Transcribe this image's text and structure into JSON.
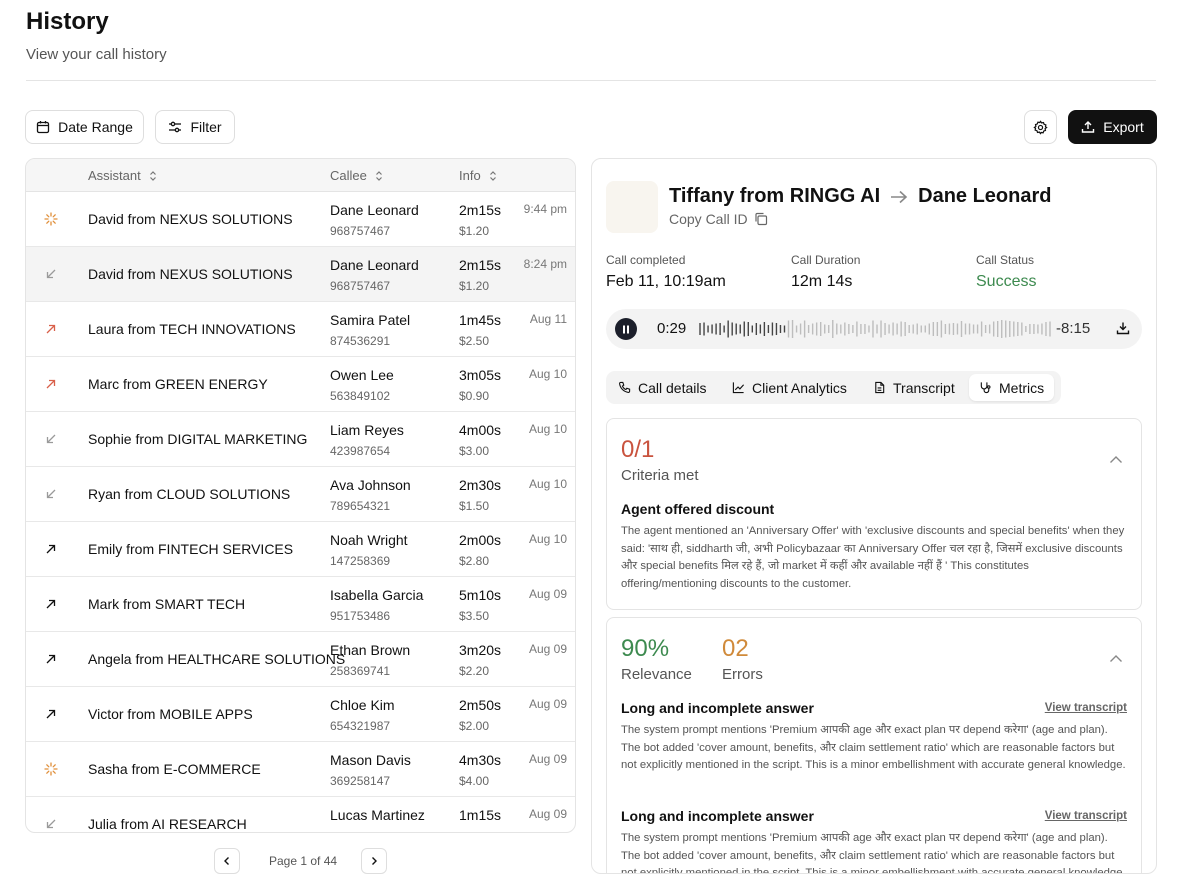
{
  "header": {
    "title": "History",
    "subtitle": "View your call history"
  },
  "toolbar": {
    "date_range_label": "Date Range",
    "filter_label": "Filter",
    "export_label": "Export"
  },
  "table": {
    "columns": [
      "Assistant",
      "Callee",
      "Info"
    ],
    "rows": [
      {
        "icon": "sparkle-icon",
        "assistant": "David from NEXUS SOLUTIONS",
        "callee": "Dane Leonard",
        "phone": "968757467",
        "duration": "2m15s",
        "cost": "$1.20",
        "time": "9:44 pm"
      },
      {
        "icon": "arrow-down-left-icon",
        "assistant": "David from NEXUS SOLUTIONS",
        "callee": "Dane Leonard",
        "phone": "968757467",
        "duration": "2m15s",
        "cost": "$1.20",
        "time": "8:24 pm",
        "selected": true
      },
      {
        "icon": "arrow-up-right-red-icon",
        "assistant": "Laura from TECH INNOVATIONS",
        "callee": "Samira Patel",
        "phone": "874536291",
        "duration": "1m45s",
        "cost": "$2.50",
        "time": "Aug 11"
      },
      {
        "icon": "arrow-up-right-red-icon",
        "assistant": "Marc from GREEN ENERGY",
        "callee": "Owen Lee",
        "phone": "563849102",
        "duration": "3m05s",
        "cost": "$0.90",
        "time": "Aug 10"
      },
      {
        "icon": "arrow-down-left-icon",
        "assistant": "Sophie from DIGITAL MARKETING",
        "callee": "Liam Reyes",
        "phone": "423987654",
        "duration": "4m00s",
        "cost": "$3.00",
        "time": "Aug 10"
      },
      {
        "icon": "arrow-down-left-icon",
        "assistant": "Ryan from CLOUD SOLUTIONS",
        "callee": "Ava Johnson",
        "phone": "789654321",
        "duration": "2m30s",
        "cost": "$1.50",
        "time": "Aug 10"
      },
      {
        "icon": "arrow-up-right-icon",
        "assistant": "Emily from FINTECH SERVICES",
        "callee": "Noah Wright",
        "phone": "147258369",
        "duration": "2m00s",
        "cost": "$2.80",
        "time": "Aug 10"
      },
      {
        "icon": "arrow-up-right-icon",
        "assistant": "Mark from SMART TECH",
        "callee": "Isabella Garcia",
        "phone": "951753486",
        "duration": "5m10s",
        "cost": "$3.50",
        "time": "Aug 09"
      },
      {
        "icon": "arrow-up-right-icon",
        "assistant": "Angela from HEALTHCARE SOLUTIONS",
        "callee": "Ethan Brown",
        "phone": "258369741",
        "duration": "3m20s",
        "cost": "$2.20",
        "time": "Aug 09"
      },
      {
        "icon": "arrow-up-right-icon",
        "assistant": "Victor from MOBILE APPS",
        "callee": "Chloe Kim",
        "phone": "654321987",
        "duration": "2m50s",
        "cost": "$2.00",
        "time": "Aug 09"
      },
      {
        "icon": "sparkle-icon",
        "assistant": "Sasha from E-COMMERCE",
        "callee": "Mason Davis",
        "phone": "369258147",
        "duration": "4m30s",
        "cost": "$4.00",
        "time": "Aug 09"
      },
      {
        "icon": "arrow-down-left-icon",
        "assistant": "Julia from AI RESEARCH",
        "callee": "Lucas Martinez",
        "phone": "",
        "duration": "1m15s",
        "cost": "",
        "time": "Aug 09"
      }
    ]
  },
  "pagination": {
    "label": "Page 1 of 44"
  },
  "details": {
    "from": "Tiffany from RINGG AI",
    "to": "Dane Leonard",
    "copy_label": "Copy Call ID",
    "meta": [
      {
        "label": "Call completed",
        "value": "Feb 11, 10:19am"
      },
      {
        "label": "Call Duration",
        "value": "12m 14s"
      },
      {
        "label": "Call Status",
        "value": "Success"
      }
    ],
    "player": {
      "elapsed": "0:29",
      "remaining": "-8:15",
      "progress": 0.06
    },
    "tabs": [
      "Call details",
      "Client Analytics",
      "Transcript",
      "Metrics"
    ],
    "active_tab": "Metrics",
    "criteria": {
      "value": "0/1",
      "label": "Criteria met",
      "item_title": "Agent offered discount",
      "item_text": "The agent mentioned an 'Anniversary Offer' with 'exclusive discounts and special benefits' when they said: 'साथ ही, siddharth जी, अभी Policybazaar का Anniversary Offer चल रहा है, जिसमें exclusive discounts और special benefits मिल रहे हैं, जो market में कहीं और available नहीं हैं ' This constitutes offering/mentioning discounts to the customer."
    },
    "relevance": {
      "value": "90%",
      "label": "Relevance",
      "errors_value": "02",
      "errors_label": "Errors",
      "issues": [
        {
          "title": "Long and incomplete answer",
          "link": "View transcript",
          "text": "The system prompt mentions 'Premium आपकी age और exact plan पर depend करेगा' (age and plan). The bot added 'cover amount, benefits, और claim settlement ratio' which are reasonable factors but not explicitly mentioned in the script. This is a minor embellishment with accurate general knowledge."
        },
        {
          "title": "Long and incomplete answer",
          "link": "View transcript",
          "text": "The system prompt mentions 'Premium आपकी age और exact plan पर depend करेगा' (age and plan). The bot added 'cover amount, benefits, और claim settlement ratio' which are reasonable factors but not explicitly mentioned in the script. This is a minor embellishment with accurate general knowledge."
        }
      ]
    }
  }
}
